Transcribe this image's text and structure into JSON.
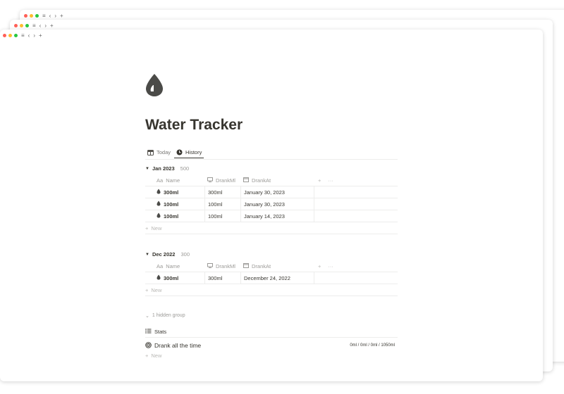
{
  "chrome": {
    "menu_glyph": "≡",
    "back_glyph": "‹",
    "forward_glyph": "›",
    "newtab_glyph": "+"
  },
  "page": {
    "icon": "water-drop-icon",
    "title": "Water Tracker"
  },
  "tabs": [
    {
      "label": "Today",
      "icon": "table-icon",
      "active": false
    },
    {
      "label": "History",
      "icon": "clock-icon",
      "active": true
    }
  ],
  "columns": {
    "name_prefix": "Aa",
    "name": "Name",
    "drank_ml": "DrankMl",
    "drank_at": "DrankAt",
    "add": "+",
    "more": "···"
  },
  "groups": [
    {
      "label": "Jan 2023",
      "count": "500",
      "rows": [
        {
          "name": "300ml",
          "drank_ml": "300ml",
          "drank_at": "January 30, 2023"
        },
        {
          "name": "100ml",
          "drank_ml": "100ml",
          "drank_at": "January 30, 2023"
        },
        {
          "name": "100ml",
          "drank_ml": "100ml",
          "drank_at": "January 14, 2023"
        }
      ],
      "new_label": "New"
    },
    {
      "label": "Dec 2022",
      "count": "300",
      "rows": [
        {
          "name": "300ml",
          "drank_ml": "300ml",
          "drank_at": "December 24, 2022"
        }
      ],
      "new_label": "New"
    }
  ],
  "hidden_group": "1 hidden group",
  "stats": {
    "view_label": "Stats",
    "row_title": "Drank all the time",
    "row_value": "0ml / 0ml / 0ml / 1050ml",
    "new_label": "New"
  },
  "colors": {
    "text": "#37352f",
    "muted": "#9b9a97",
    "border": "#ededec",
    "icon_dark": "#4b4b48"
  }
}
